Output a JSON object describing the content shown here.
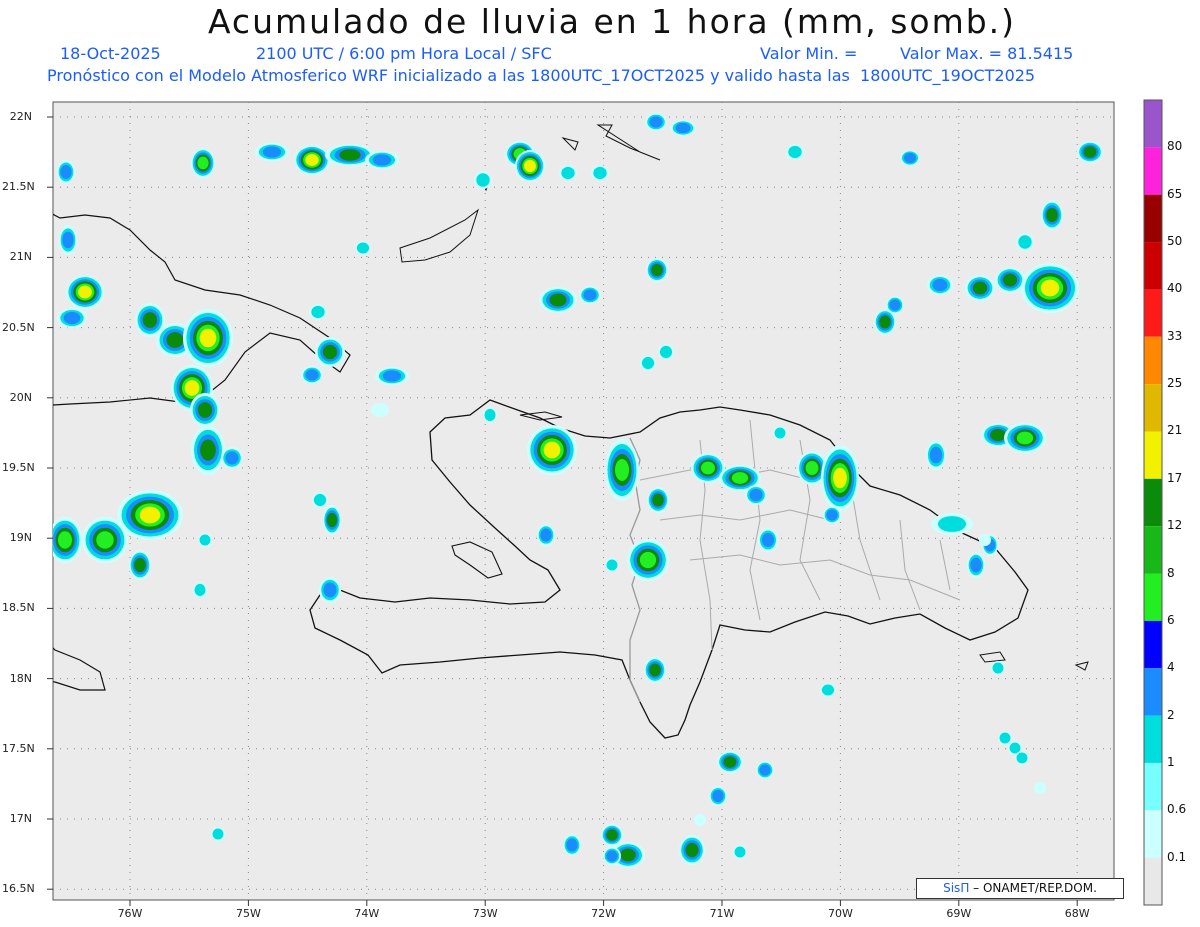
{
  "title": "Acumulado de lluvia en 1 hora (mm, somb.)",
  "date": "18-Oct-2025",
  "time": "2100 UTC / 6:00 pm Hora Local / SFC",
  "vmin": "Valor Min. =",
  "vmax": "Valor Max. = 81.5415",
  "model_line": "Pronóstico con el Modelo Atmosferico WRF inicializado a las 1800UTC_17OCT2025 y valido hasta las  1800UTC_19OCT2025",
  "credit_brand": "SisΠ",
  "credit_text": "– ONAMET/REP.DOM.",
  "lat_labels": [
    "22N",
    "21.5N",
    "21N",
    "20.5N",
    "20N",
    "19.5N",
    "19N",
    "18.5N",
    "18N",
    "17.5N",
    "17N",
    "16.5N"
  ],
  "lon_labels": [
    "76W",
    "75W",
    "74W",
    "73W",
    "72W",
    "71W",
    "70W",
    "69W",
    "68W"
  ],
  "colorbar": {
    "labels": [
      "80",
      "65",
      "50",
      "40",
      "33",
      "25",
      "21",
      "17",
      "12",
      "8",
      "6",
      "4",
      "2",
      "1",
      "0.6",
      "0.1"
    ],
    "colors": [
      "#9a55cc",
      "#ff22dd",
      "#990000",
      "#cc0000",
      "#ff1a1a",
      "#ff8800",
      "#e0b800",
      "#f2f200",
      "#0a8c0a",
      "#18b818",
      "#22ee22",
      "#0000ff",
      "#1a8cff",
      "#00dddd",
      "#77ffff",
      "#ccffff",
      "#e8e8e8"
    ]
  },
  "colors": {
    "land": "#ebebeb",
    "title_blue": "#1a5cff",
    "border": "#999999"
  }
}
